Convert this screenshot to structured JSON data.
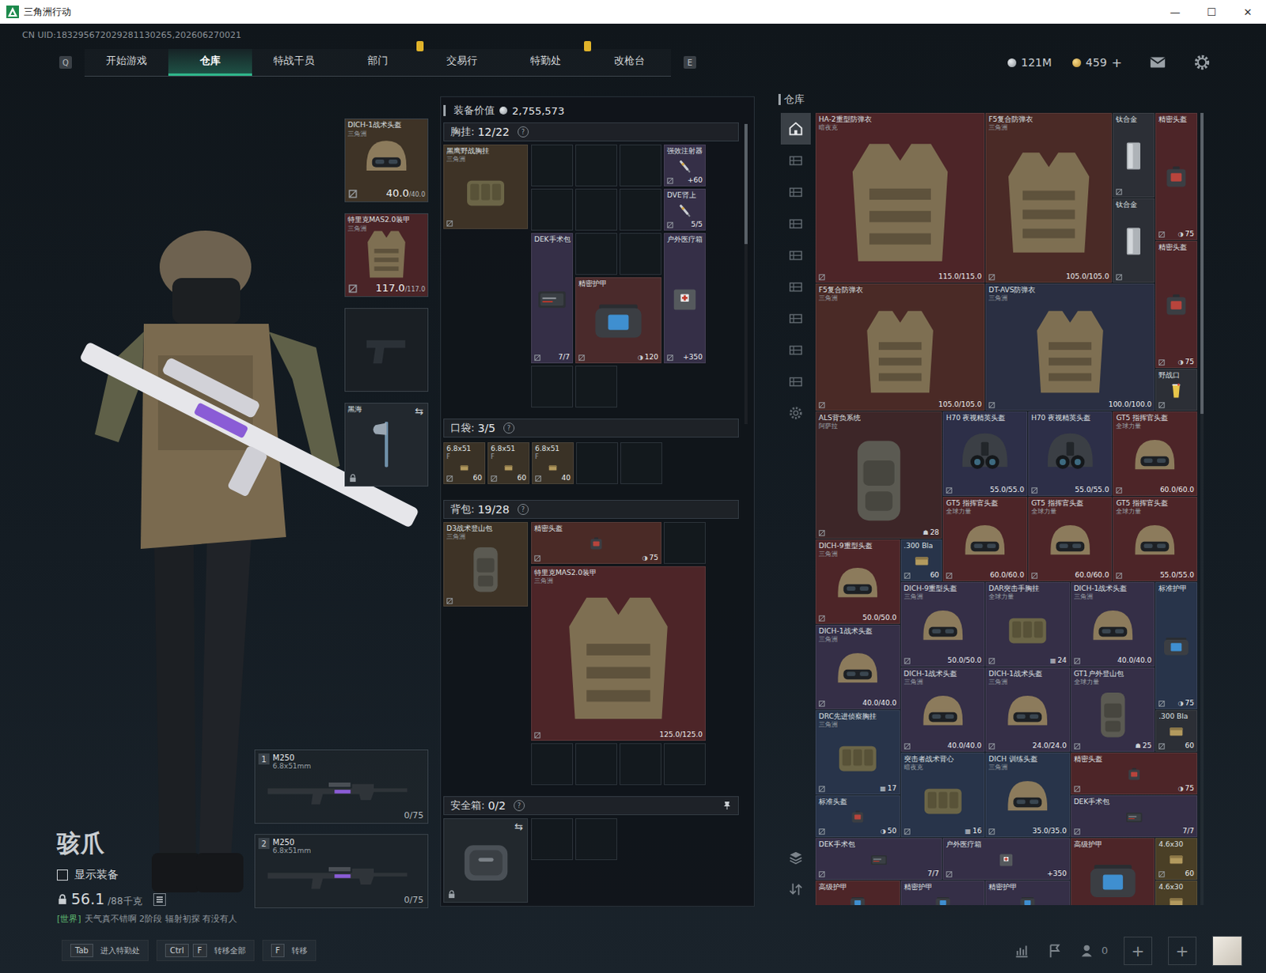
{
  "window": {
    "title": "三角洲行动",
    "controls": [
      "—",
      "☐",
      "✕"
    ]
  },
  "header": {
    "uid": "CN UID:183295672029281130265,202606270021",
    "prevKey": "Q",
    "nextKey": "E",
    "tabs": [
      {
        "label": "开始游戏",
        "selected": false,
        "alert": false
      },
      {
        "label": "仓库",
        "selected": true,
        "alert": false
      },
      {
        "label": "特战干员",
        "selected": false,
        "alert": false
      },
      {
        "label": "部门",
        "selected": false,
        "alert": true
      },
      {
        "label": "交易行",
        "selected": false,
        "alert": false
      },
      {
        "label": "特勤处",
        "selected": false,
        "alert": true
      },
      {
        "label": "改枪台",
        "selected": false,
        "alert": false
      }
    ],
    "currencies": [
      {
        "kind": "coin",
        "value": "121M"
      },
      {
        "kind": "gold",
        "value": "459",
        "plus": "+"
      }
    ]
  },
  "operator": {
    "name": "骇爪",
    "showGear": {
      "label": "显示装备",
      "checked": false
    },
    "weight": {
      "current": "56.1",
      "max": "/88千克"
    },
    "chat": {
      "channel": "[世界]",
      "message": "天气真不错啊  2阶段  辐射初探  有没有人"
    }
  },
  "gear": [
    {
      "kind": "helmet",
      "empty": false,
      "name": "DICH-1战术头盔",
      "brand": "三角洲",
      "value": "40.0",
      "max": "/40.0",
      "color": "#3e3326",
      "locked": false
    },
    {
      "kind": "armor",
      "empty": false,
      "name": "特里克MAS2.0装甲",
      "brand": "三角洲",
      "value": "117.0",
      "max": "/117.0",
      "color": "#4a2427",
      "locked": false
    },
    {
      "kind": "pistol",
      "empty": true,
      "color": "#1a1f24",
      "locked": false
    },
    {
      "kind": "melee",
      "empty": false,
      "name": "黑海",
      "color": "#22282e",
      "locked": true,
      "swap": "⇆"
    }
  ],
  "weapons": [
    {
      "index": "1",
      "name": "M250",
      "caliber": "6.8x51mm",
      "ammo": "0/75"
    },
    {
      "index": "2",
      "name": "M250",
      "caliber": "6.8x51mm",
      "ammo": "0/75"
    }
  ],
  "loadout": {
    "valueLabel": "装备价值",
    "value": "2,755,573",
    "rig": {
      "title": "胸挂:",
      "count": "12/22",
      "help": "?",
      "item": {
        "empty": false,
        "name": "黑鹰野战胸挂",
        "brand": "三角洲",
        "kind": "rig",
        "color": "#3e3326"
      },
      "entries": [
        {
          "empty": true,
          "cells": "1x1"
        },
        {
          "empty": true,
          "cells": "1x1"
        },
        {
          "empty": true,
          "cells": "1x1"
        },
        {
          "empty": false,
          "name": "强效注射器",
          "value": "+60",
          "kind": "syringe",
          "cells": "1x1",
          "color": "#352f47"
        },
        {
          "empty": true,
          "cells": "1x1"
        },
        {
          "empty": true,
          "cells": "1x1"
        },
        {
          "empty": true,
          "cells": "1x1"
        },
        {
          "empty": false,
          "name": "DVE肾上",
          "value": "5/5",
          "kind": "syringe",
          "cells": "1x1",
          "color": "#352f47"
        },
        {
          "empty": false,
          "name": "DEK手术包",
          "value": "7/7",
          "kind": "surgkit",
          "cells": "1x3",
          "color": "#352f47"
        },
        {
          "empty": true,
          "cells": "1x1"
        },
        {
          "empty": true,
          "cells": "1x1"
        },
        {
          "empty": false,
          "name": "户外医疗箱",
          "value": "+350",
          "kind": "medkit",
          "cells": "1x3",
          "color": "#352f47"
        },
        {
          "empty": false,
          "name": "精密护甲",
          "value": "120",
          "mark": "◑",
          "kind": "armorkit",
          "cells": "2x2",
          "color": "#4a2a2b"
        },
        {
          "empty": true,
          "cells": "1x1"
        },
        {
          "empty": true,
          "cells": "1x1"
        }
      ]
    },
    "pockets": {
      "title": "口袋:",
      "count": "3/5",
      "help": "?",
      "entries": [
        {
          "empty": false,
          "name": "6.8x51",
          "brand": "F",
          "value": "60",
          "kind": "ammo",
          "color": "#3a3226"
        },
        {
          "empty": false,
          "name": "6.8x51",
          "brand": "F",
          "value": "60",
          "kind": "ammo",
          "color": "#3a3226"
        },
        {
          "empty": false,
          "name": "6.8x51",
          "brand": "F",
          "value": "40",
          "kind": "ammo",
          "color": "#3a3226"
        },
        {
          "empty": true
        },
        {
          "empty": true
        }
      ]
    },
    "backpack": {
      "title": "背包:",
      "count": "19/28",
      "help": "?",
      "item": {
        "empty": false,
        "name": "D3战术登山包",
        "brand": "三角洲",
        "kind": "bag",
        "color": "#3e3326"
      },
      "entries": [
        {
          "empty": false,
          "name": "精密头盔",
          "value": "75",
          "mark": "◑",
          "kind": "helmetkit",
          "cells": "3x1",
          "color": "#4a2a26"
        },
        {
          "empty": true,
          "cells": "1x1"
        },
        {
          "empty": false,
          "name": "特里克MAS2.0装甲",
          "brand": "三角洲",
          "value": "125.0/125.0",
          "kind": "armor",
          "cells": "4x4",
          "color": "#4d2528"
        },
        {
          "empty": true,
          "cells": "1x1"
        },
        {
          "empty": true,
          "cells": "1x1"
        },
        {
          "empty": true,
          "cells": "1x1"
        },
        {
          "empty": true,
          "cells": "1x1"
        }
      ]
    },
    "safe": {
      "title": "安全箱:",
      "count": "0/2",
      "help": "?",
      "swap": "⇆",
      "locked": true,
      "entries": [
        {
          "empty": true,
          "cells": "1x1"
        },
        {
          "empty": true,
          "cells": "1x1"
        }
      ]
    }
  },
  "warehouse": {
    "title": "仓库",
    "sideTabs": [
      {
        "kind": "home",
        "selected": true
      },
      {
        "kind": "box",
        "selected": false
      },
      {
        "kind": "box",
        "selected": false
      },
      {
        "kind": "box",
        "selected": false
      },
      {
        "kind": "box",
        "selected": false
      },
      {
        "kind": "box",
        "selected": false
      },
      {
        "kind": "box",
        "selected": false
      },
      {
        "kind": "box",
        "selected": false
      },
      {
        "kind": "box",
        "selected": false
      },
      {
        "kind": "gear",
        "selected": false
      }
    ],
    "tools": [
      {
        "kind": "layers"
      },
      {
        "kind": "sort"
      }
    ],
    "items": [
      {
        "empty": false,
        "name": "HA-2重型防弹衣",
        "brand": "暗夜克",
        "value": "115.0/115.0",
        "kind": "armor",
        "cells": "4x4",
        "color": "#4d2528"
      },
      {
        "empty": false,
        "name": "F5复合防弹衣",
        "brand": "三角洲",
        "value": "105.0/105.0",
        "kind": "armor",
        "cells": "3x4",
        "color": "#4a2a26"
      },
      {
        "empty": false,
        "name": "钛合金",
        "kind": "plate",
        "cells": "1x2",
        "color": "#2c2f36"
      },
      {
        "empty": false,
        "name": "精密头盔",
        "value": "75",
        "mark": "◑",
        "kind": "helmetkit",
        "cells": "1x3",
        "color": "#4d2528"
      },
      {
        "empty": false,
        "name": "钛合金",
        "kind": "plate",
        "cells": "1x2",
        "color": "#2c2f36"
      },
      {
        "empty": false,
        "name": "精密头盔",
        "value": "75",
        "mark": "◑",
        "kind": "helmetkit",
        "cells": "1x3",
        "color": "#4d2528"
      },
      {
        "empty": false,
        "name": "F5复合防弹衣",
        "brand": "三角洲",
        "value": "105.0/105.0",
        "kind": "armor",
        "cells": "4x3",
        "color": "#4a2a26"
      },
      {
        "empty": false,
        "name": "DT-AVS防弹衣",
        "brand": "三角洲",
        "value": "100.0/100.0",
        "kind": "armor",
        "cells": "4x3",
        "color": "#2a2f42"
      },
      {
        "empty": false,
        "name": "野战口",
        "kind": "drink",
        "cells": "1x1",
        "color": "#2c2f36"
      },
      {
        "empty": false,
        "name": "ALS背负系统",
        "brand": "阿萨拉",
        "value": "28",
        "mark": "☗",
        "kind": "bag",
        "cells": "3x3",
        "color": "#3d2628"
      },
      {
        "empty": false,
        "name": "H70 夜视精英头盔",
        "value": "55.0/55.0",
        "kind": "nvg",
        "cells": "2x2",
        "color": "#2d2f48"
      },
      {
        "empty": false,
        "name": "H70 夜视精英头盔",
        "value": "55.0/55.0",
        "kind": "nvg",
        "cells": "2x2",
        "color": "#2d2f48"
      },
      {
        "empty": false,
        "name": "GT5 指挥官头盔",
        "brand": "全球力量",
        "value": "60.0/60.0",
        "kind": "helmet",
        "cells": "2x2",
        "color": "#4d2528"
      },
      {
        "empty": false,
        "name": "GT5 指挥官头盔",
        "brand": "全球力量",
        "value": "60.0/60.0",
        "kind": "helmet",
        "cells": "2x2",
        "color": "#4d2528"
      },
      {
        "empty": false,
        "name": "GT5 指挥官头盔",
        "brand": "全球力量",
        "value": "60.0/60.0",
        "kind": "helmet",
        "cells": "2x2",
        "color": "#4d2528"
      },
      {
        "empty": false,
        "name": "GT5 指挥官头盔",
        "brand": "全球力量",
        "value": "55.0/55.0",
        "kind": "helmet",
        "cells": "2x2",
        "color": "#4d2528"
      },
      {
        "empty": false,
        "name": "DICH-9重型头盔",
        "brand": "三角洲",
        "value": "50.0/50.0",
        "kind": "helmet",
        "cells": "2x2",
        "color": "#4d2528"
      },
      {
        "empty": false,
        "name": ".300 Bla",
        "value": "60",
        "kind": "ammo",
        "cells": "1x1",
        "color": "#28344a"
      },
      {
        "empty": false,
        "name": "DICH-9重型头盔",
        "brand": "三角洲",
        "value": "50.0/50.0",
        "kind": "helmet",
        "cells": "2x2",
        "color": "#352f47"
      },
      {
        "empty": false,
        "name": "DAR突击手胸挂",
        "brand": "全球力量",
        "value": "24",
        "mark": "▦",
        "kind": "rig",
        "cells": "2x2",
        "color": "#352f47"
      },
      {
        "empty": false,
        "name": "DICH-1战术头盔",
        "brand": "三角洲",
        "value": "40.0/40.0",
        "kind": "helmet",
        "cells": "2x2",
        "color": "#352f47"
      },
      {
        "empty": false,
        "name": "标准护甲",
        "value": "75",
        "mark": "◑",
        "kind": "armorkit",
        "cells": "1x3",
        "color": "#28344a"
      },
      {
        "empty": false,
        "name": "DICH-1战术头盔",
        "brand": "三角洲",
        "value": "40.0/40.0",
        "kind": "helmet",
        "cells": "2x2",
        "color": "#352f47"
      },
      {
        "empty": false,
        "name": "DICH-1战术头盔",
        "brand": "三角洲",
        "value": "40.0/40.0",
        "kind": "helmet",
        "cells": "2x2",
        "color": "#352f47"
      },
      {
        "empty": false,
        "name": "DICH-1战术头盔",
        "brand": "三角洲",
        "value": "24.0/24.0",
        "kind": "helmet",
        "cells": "2x2",
        "color": "#352f47"
      },
      {
        "empty": false,
        "name": "GT1户外登山包",
        "brand": "全球力量",
        "value": "25",
        "mark": "☗",
        "kind": "bag",
        "cells": "2x2",
        "color": "#352f47"
      },
      {
        "empty": false,
        "name": "DRC先进侦察胸挂",
        "brand": "三角洲",
        "value": "17",
        "mark": "▦",
        "kind": "rig",
        "cells": "2x2",
        "color": "#28344a"
      },
      {
        "empty": false,
        "name": ".300 Bla",
        "value": "60",
        "kind": "ammo",
        "cells": "1x1",
        "color": "#2c2f36"
      },
      {
        "empty": false,
        "name": "突击者战术背心",
        "brand": "暗夜克",
        "value": "16",
        "mark": "▦",
        "kind": "rig",
        "cells": "2x2",
        "color": "#28344a"
      },
      {
        "empty": false,
        "name": "DICH 训练头盔",
        "brand": "三角洲",
        "value": "35.0/35.0",
        "kind": "helmet",
        "cells": "2x2",
        "color": "#28344a"
      },
      {
        "empty": false,
        "name": "精密头盔",
        "value": "75",
        "mark": "◑",
        "kind": "helmetkit",
        "cells": "3x1",
        "color": "#4d2528"
      },
      {
        "empty": false,
        "name": "标准头盔",
        "value": "50",
        "mark": "◑",
        "kind": "helmetkit",
        "cells": "2x1",
        "color": "#28344a"
      },
      {
        "empty": false,
        "name": "DEK手术包",
        "value": "7/7",
        "kind": "surgkit",
        "cells": "3x1",
        "color": "#352f47"
      },
      {
        "empty": false,
        "name": "DEK手术包",
        "value": "7/7",
        "kind": "surgkit",
        "cells": "3x1",
        "color": "#352f47"
      },
      {
        "empty": false,
        "name": "户外医疗箱",
        "value": "+350",
        "kind": "medkit",
        "cells": "3x1",
        "color": "#352f47"
      },
      {
        "empty": false,
        "name": "高级护甲",
        "kind": "armorkit",
        "cells": "2x2",
        "color": "#4d2528"
      },
      {
        "empty": false,
        "name": "4.6x30",
        "value": "60",
        "kind": "ammo",
        "cells": "1x1",
        "color": "#4a3f26"
      },
      {
        "empty": false,
        "name": "高级护甲",
        "kind": "armorkit",
        "cells": "2x1",
        "color": "#4d2528"
      },
      {
        "empty": false,
        "name": "精密护甲",
        "kind": "armorkit",
        "cells": "2x1",
        "color": "#352f47"
      },
      {
        "empty": false,
        "name": "精密护甲",
        "kind": "armorkit",
        "cells": "2x1",
        "color": "#352f47"
      },
      {
        "empty": false,
        "name": "4.6x30",
        "kind": "ammo",
        "cells": "1x1",
        "color": "#4a3f26"
      }
    ]
  },
  "footer": {
    "hints": [
      {
        "keys": [
          "Tab"
        ],
        "label": "进入特勤处"
      },
      {
        "keys": [
          "Ctrl",
          "F"
        ],
        "label": "转移全部"
      },
      {
        "keys": [
          "F"
        ],
        "label": "转移"
      }
    ],
    "friends": "0",
    "slots": [
      "+",
      "+"
    ]
  }
}
